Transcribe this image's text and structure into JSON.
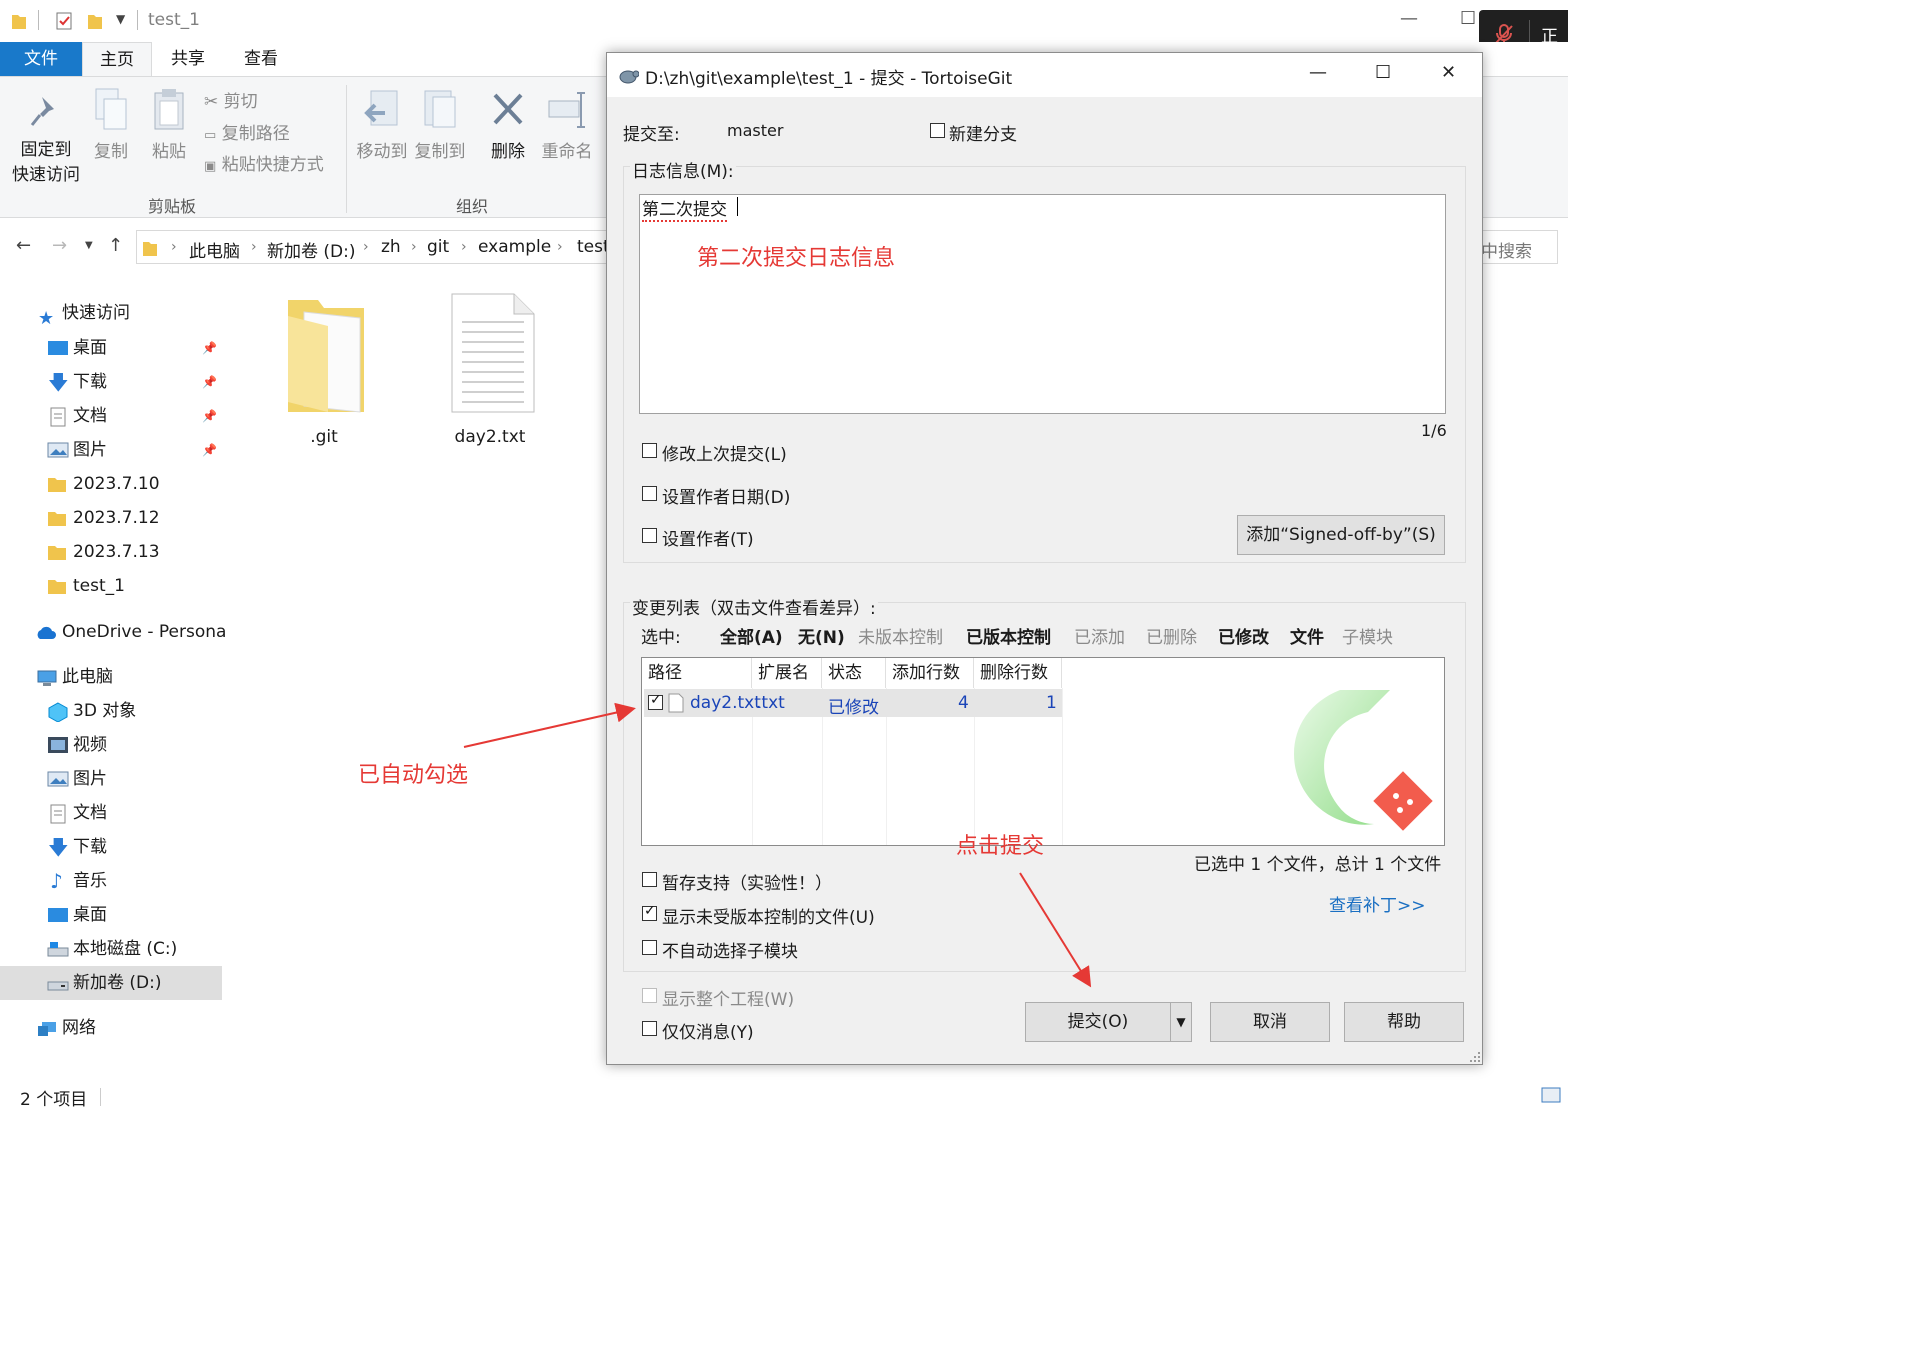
{
  "explorer": {
    "window_title": "test_1",
    "ribbon_tabs": [
      "文件",
      "主页",
      "共享",
      "查看"
    ],
    "clipboard": {
      "pin_label_1": "固定到",
      "pin_label_2": "快速访问",
      "copy": "复制",
      "paste": "粘贴",
      "cut": "剪切",
      "copy_path": "复制路径",
      "paste_shortcut": "粘贴快捷方式",
      "group": "剪贴板"
    },
    "organize": {
      "move_to": "移动到",
      "copy_to": "复制到",
      "delete": "删除",
      "rename": "重命名",
      "group": "组织"
    },
    "breadcrumbs": [
      "此电脑",
      "新加卷 (D:)",
      "zh",
      "git",
      "example",
      "test"
    ],
    "search_placeholder": "中搜索",
    "nav": {
      "quick_access": "快速访问",
      "quick_items": [
        {
          "label": "桌面",
          "pinned": true
        },
        {
          "label": "下载",
          "pinned": true
        },
        {
          "label": "文档",
          "pinned": true
        },
        {
          "label": "图片",
          "pinned": true
        },
        {
          "label": "2023.7.10",
          "pinned": false
        },
        {
          "label": "2023.7.12",
          "pinned": false
        },
        {
          "label": "2023.7.13",
          "pinned": false
        },
        {
          "label": "test_1",
          "pinned": false
        }
      ],
      "onedrive": "OneDrive - Persona",
      "this_pc": "此电脑",
      "pc_items": [
        "3D 对象",
        "视频",
        "图片",
        "文档",
        "下载",
        "音乐",
        "桌面",
        "本地磁盘 (C:)",
        "新加卷 (D:)"
      ],
      "network": "网络"
    },
    "files": [
      ".git",
      "day2.txt"
    ],
    "status": "2 个项目"
  },
  "dialog": {
    "title": "D:\\zh\\git\\example\\test_1 - 提交 - TortoiseGit",
    "commit_to_label": "提交至:",
    "branch": "master",
    "new_branch": "新建分支",
    "log_label": "日志信息(M):",
    "message_text": "第二次提交",
    "counter": "1/6",
    "amend": "修改上次提交(L)",
    "set_author_date": "设置作者日期(D)",
    "set_author": "设置作者(T)",
    "signoff_button": "添加“Signed-off-by”(S)",
    "changes_label": "变更列表（双击文件查看差异）:",
    "select_label": "选中:",
    "filters": [
      {
        "label": "全部(A)",
        "active": true
      },
      {
        "label": "无(N)",
        "active": true
      },
      {
        "label": "未版本控制",
        "active": false
      },
      {
        "label": "已版本控制",
        "active": true
      },
      {
        "label": "已添加",
        "active": false
      },
      {
        "label": "已删除",
        "active": false
      },
      {
        "label": "已修改",
        "active": true
      },
      {
        "label": "文件",
        "active": true
      },
      {
        "label": "子模块",
        "active": false
      }
    ],
    "columns": [
      "路径",
      "扩展名",
      "状态",
      "添加行数",
      "删除行数"
    ],
    "rows": [
      {
        "checked": true,
        "path": "day2.txt",
        "ext": ".txt",
        "status": "已修改",
        "added": "4",
        "deleted": "1"
      }
    ],
    "selection_summary": "已选中 1 个文件，总计 1 个文件",
    "stash_support": "暂存支持（实验性！）",
    "show_unversioned": "显示未受版本控制的文件(U)",
    "no_autoselect_submodules": "不自动选择子模块",
    "view_patch": "查看补丁>>",
    "show_whole_project": "显示整个工程(W)",
    "message_only": "仅仅消息(Y)",
    "commit_button": "提交(O)",
    "cancel_button": "取消",
    "help_button": "帮助"
  },
  "annotations": {
    "log_note": "第二次提交日志信息",
    "auto_checked": "已自动勾选",
    "click_commit": "点击提交"
  },
  "recording_indicator": "正在",
  "colors": {
    "annotation_red": "#e53935",
    "link_blue": "#1a6fc2",
    "file_tab_blue": "#1979ca"
  }
}
